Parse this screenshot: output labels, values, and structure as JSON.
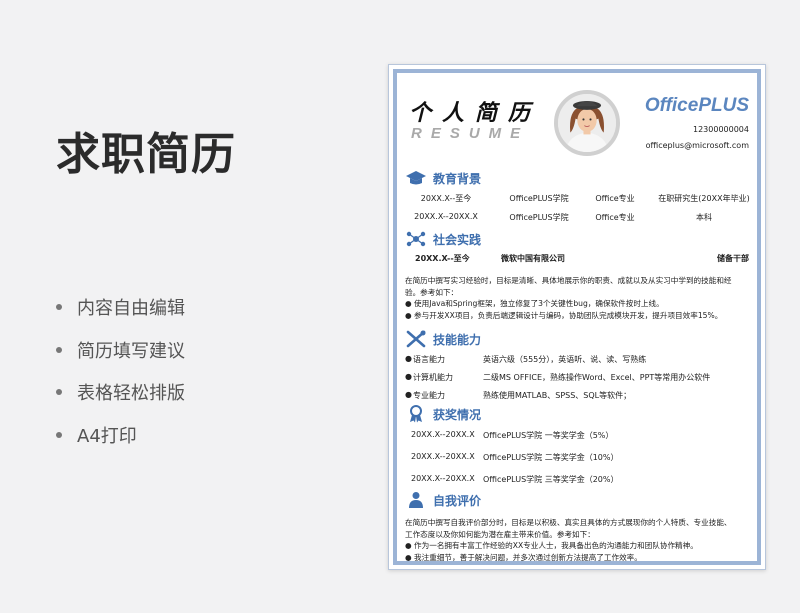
{
  "promo": {
    "title": "求职简历",
    "features": [
      "内容自由编辑",
      "简历填写建议",
      "表格轻松排版",
      "A4打印"
    ]
  },
  "resume": {
    "header": {
      "title_cn": "个人简历",
      "title_en": "RESUME",
      "brand": "OfficePLUS",
      "phone": "12300000004",
      "email": "officeplus@microsoft.com"
    },
    "education": {
      "title": "教育背景",
      "rows": [
        [
          "20XX.X--至今",
          "OfficePLUS学院",
          "Office专业",
          "在职研究生(20XX年毕业)"
        ],
        [
          "20XX.X--20XX.X",
          "OfficePLUS学院",
          "Office专业",
          "本科"
        ]
      ]
    },
    "practice": {
      "title": "社会实践",
      "period": "20XX.X--至今",
      "company": "微软中国有限公司",
      "role": "储备干部",
      "description": [
        "在简历中撰写实习经验时，目标是清晰、具体地展示你的职责、成就以及从实习中学到的技能和经",
        "验。参考如下：",
        "● 使用Java和Spring框架，独立修复了3个关键性bug，确保软件按时上线。",
        "● 参与开发XX项目，负责后端逻辑设计与编码，协助团队完成模块开发，提升项目效率15%。"
      ]
    },
    "skills": {
      "title": "技能能力",
      "items": [
        {
          "label": "语言能力",
          "value": "英语六级（555分），英语听、说、读、写熟练"
        },
        {
          "label": "计算机能力",
          "value": "二级MS OFFICE，熟练操作Word、Excel、PPT等常用办公软件"
        },
        {
          "label": "专业能力",
          "value": "熟练使用MATLAB、SPSS、SQL等软件；"
        }
      ]
    },
    "awards": {
      "title": "获奖情况",
      "items": [
        {
          "period": "20XX.X--20XX.X",
          "text": "OfficePLUS学院  一等奖学金（5%）"
        },
        {
          "period": "20XX.X--20XX.X",
          "text": "OfficePLUS学院  二等奖学金（10%）"
        },
        {
          "period": "20XX.X--20XX.X",
          "text": "OfficePLUS学院  三等奖学金（20%）"
        }
      ]
    },
    "self_eval": {
      "title": "自我评价",
      "lines": [
        "在简历中撰写自我评价部分时，目标是以积极、真实且具体的方式展现你的个人特质、专业技能、",
        "工作态度以及你如何能为潜在雇主带来价值。参考如下：",
        "● 作为一名拥有丰富工作经验的XX专业人士，我具备出色的沟通能力和团队协作精神。",
        "● 我注重细节，善于解决问题，并多次通过创新方法提高了工作效率。"
      ]
    },
    "accent_color": "#3f6fae",
    "frame_color": "#9cb4d6"
  }
}
